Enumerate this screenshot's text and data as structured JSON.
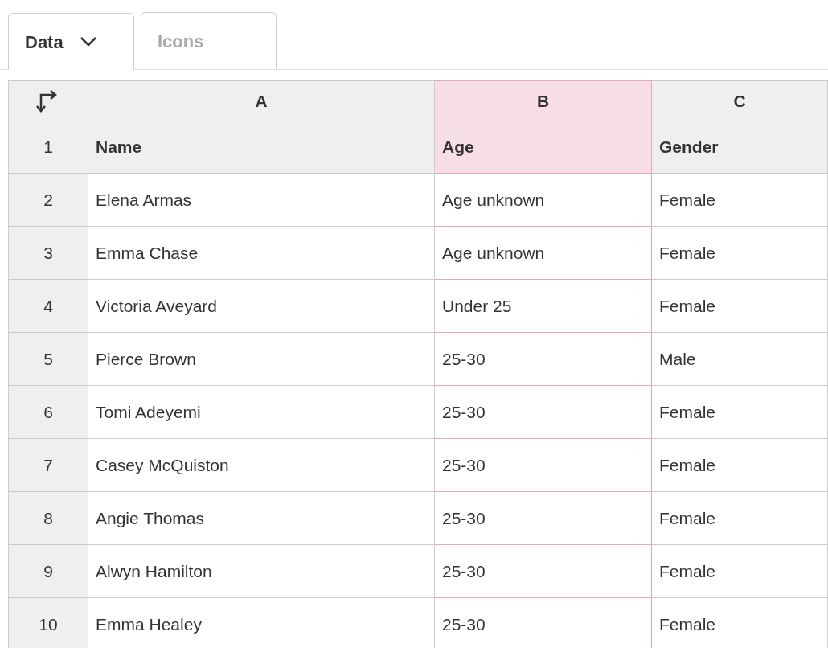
{
  "tabs": [
    {
      "label": "Data",
      "selected": true,
      "kind": "dropdown"
    },
    {
      "label": "Icons",
      "selected": false,
      "kind": "plain"
    }
  ],
  "columns": [
    {
      "label": "A",
      "selected": false
    },
    {
      "label": "B",
      "selected": true
    },
    {
      "label": "C",
      "selected": false
    }
  ],
  "rows": [
    {
      "number": "1",
      "kind": "header",
      "cells": [
        "Name",
        "Age",
        "Gender"
      ]
    },
    {
      "number": "2",
      "kind": "data",
      "cells": [
        "Elena Armas",
        "Age unknown",
        "Female"
      ]
    },
    {
      "number": "3",
      "kind": "data",
      "cells": [
        "Emma Chase",
        "Age unknown",
        "Female"
      ]
    },
    {
      "number": "4",
      "kind": "data",
      "cells": [
        "Victoria Aveyard",
        "Under 25",
        "Female"
      ]
    },
    {
      "number": "5",
      "kind": "data",
      "cells": [
        "Pierce Brown",
        "25-30",
        "Male"
      ]
    },
    {
      "number": "6",
      "kind": "data",
      "cells": [
        "Tomi Adeyemi",
        "25-30",
        "Female"
      ]
    },
    {
      "number": "7",
      "kind": "data",
      "cells": [
        "Casey McQuiston",
        "25-30",
        "Female"
      ]
    },
    {
      "number": "8",
      "kind": "data",
      "cells": [
        "Angie Thomas",
        "25-30",
        "Female"
      ]
    },
    {
      "number": "9",
      "kind": "data",
      "cells": [
        "Alwyn Hamilton",
        "25-30",
        "Female"
      ]
    },
    {
      "number": "10",
      "kind": "data",
      "cells": [
        "Emma Healey",
        "25-30",
        "Female"
      ]
    }
  ]
}
